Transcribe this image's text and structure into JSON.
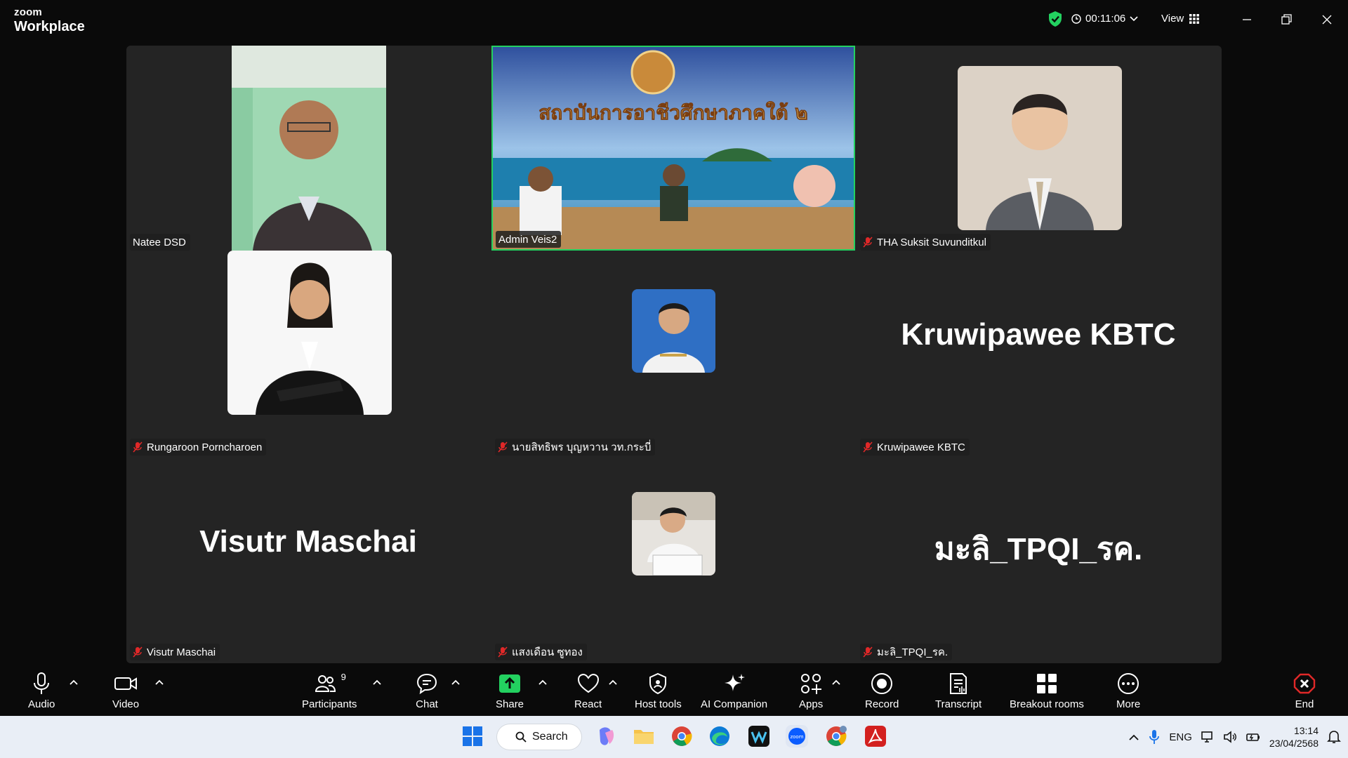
{
  "app": {
    "brand_small": "zoom",
    "brand_big": "Workplace"
  },
  "titlebar": {
    "timer": "00:11:06",
    "view_label": "View"
  },
  "colors": {
    "accent_green": "#23d160",
    "zoom_blue": "#0b5cff",
    "muted_red": "#e02828",
    "end_red": "#e02828",
    "tile_bg": "#242424"
  },
  "tiles": [
    {
      "name": "Natee DSD",
      "muted": false,
      "type": "video"
    },
    {
      "name": "Admin Veis2",
      "muted": false,
      "type": "video",
      "active_speaker": true,
      "banner_text": "สถาบันการอาชีวศึกษาภาคใต้ ๒"
    },
    {
      "name": "THA Suksit Suvunditkul",
      "muted": true,
      "type": "photo"
    },
    {
      "name": "Rungaroon Porncharoen",
      "muted": true,
      "type": "photo"
    },
    {
      "name": "นายสิทธิพร บุญหวาน วท.กระบี่",
      "muted": true,
      "type": "photo"
    },
    {
      "name": "Kruwipawee KBTC",
      "muted": true,
      "type": "name",
      "display_name": "Kruwipawee KBTC"
    },
    {
      "name": "Visutr Maschai",
      "muted": true,
      "type": "name",
      "display_name": "Visutr Maschai"
    },
    {
      "name": "แสงเดือน ซูทอง",
      "muted": true,
      "type": "photo"
    },
    {
      "name": "มะลิ_TPQI_รค.",
      "muted": true,
      "type": "name",
      "display_name": "มะลิ_TPQI_รค."
    }
  ],
  "controls": {
    "audio": "Audio",
    "video": "Video",
    "participants": "Participants",
    "participants_count": "9",
    "chat": "Chat",
    "share": "Share",
    "react": "React",
    "host_tools": "Host tools",
    "ai_companion": "AI Companion",
    "apps": "Apps",
    "record": "Record",
    "transcript": "Transcript",
    "breakout_rooms": "Breakout rooms",
    "more": "More",
    "end": "End"
  },
  "taskbar": {
    "search_label": "Search",
    "language": "ENG",
    "time": "13:14",
    "date": "23/04/2568"
  }
}
